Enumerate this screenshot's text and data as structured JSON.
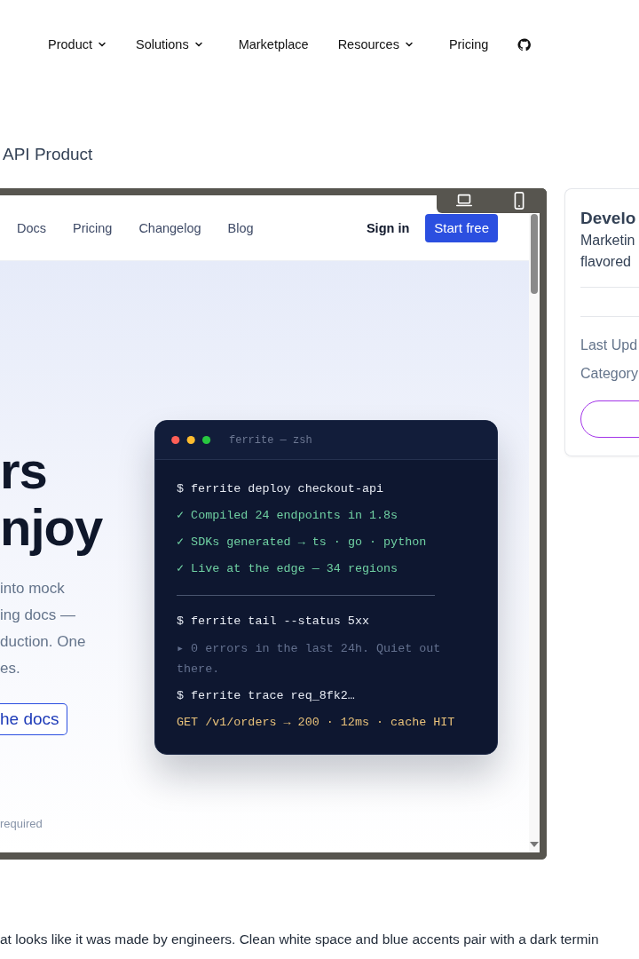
{
  "top_nav": [
    {
      "label": "Product",
      "dropdown": true
    },
    {
      "label": "Solutions",
      "dropdown": true
    },
    {
      "label": "Marketplace",
      "dropdown": false
    },
    {
      "label": "Resources",
      "dropdown": true
    },
    {
      "label": "Pricing",
      "dropdown": false
    }
  ],
  "page_title": "API Product",
  "preview": {
    "nav_links": [
      "Docs",
      "Pricing",
      "Changelog",
      "Blog"
    ],
    "sign_in": "Sign in",
    "cta": "Start free",
    "headline": [
      "rs",
      "njoy"
    ],
    "body_lines": [
      "into mock",
      "ing docs —",
      "duction. One",
      "es."
    ],
    "secondary_button": "he docs",
    "note": "required",
    "terminal": {
      "title": "ferrite — zsh",
      "lines": [
        {
          "kind": "cmd",
          "text": "$ ferrite deploy checkout-api"
        },
        {
          "kind": "ok",
          "text": "✓ Compiled 24 endpoints in 1.8s"
        },
        {
          "kind": "ok",
          "text": "✓ SDKs generated → ts · go · python"
        },
        {
          "kind": "ok",
          "text": "✓ Live at the edge — 34 regions"
        },
        {
          "kind": "rule"
        },
        {
          "kind": "cmd",
          "text": "$ ferrite tail --status 5xx"
        },
        {
          "kind": "muted",
          "text": "▸ 0 errors in the last 24h. Quiet out there."
        },
        {
          "kind": "cmd",
          "text": "$ ferrite trace req_8fk2…"
        },
        {
          "kind": "result",
          "text": "GET /v1/orders → 200 · 12ms · cache HIT"
        }
      ]
    }
  },
  "card": {
    "title": "Develo",
    "description": [
      "Marketin",
      "flavored"
    ],
    "meta": [
      "Last Upd",
      "Category"
    ]
  },
  "description": "at looks like it was made by engineers. Clean white space and blue accents pair with a dark termin"
}
